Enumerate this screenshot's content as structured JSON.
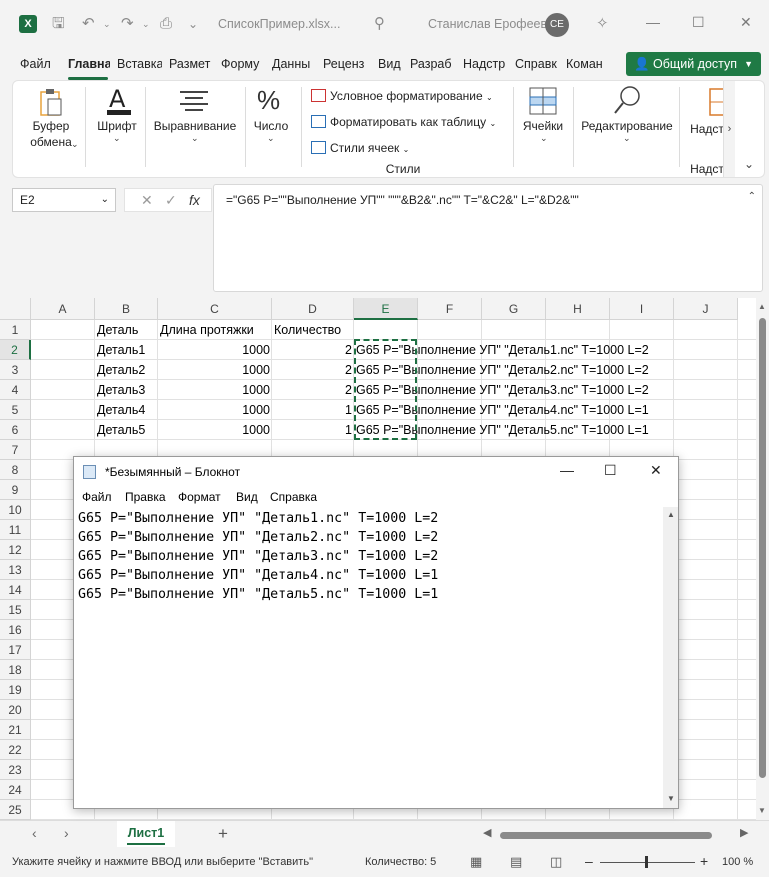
{
  "titlebar": {
    "filename": "СписокПример.xlsx...",
    "user": "Станислав Ерофеев",
    "avatar": "CE",
    "app_icon": "X"
  },
  "ribbon_tabs": [
    "Файл",
    "Главна",
    "Вставка",
    "Размет",
    "Форму",
    "Данны",
    "Реценз",
    "Вид",
    "Разраб",
    "Надстр",
    "Справк",
    "Коман"
  ],
  "share_label": "Общий доступ",
  "ribbon": {
    "clipboard_line1": "Буфер",
    "clipboard_line2": "обмена",
    "font": "Шрифт",
    "alignment": "Выравнивание",
    "number": "Число",
    "cond_format": "Условное форматирование",
    "format_table": "Форматировать как таблицу",
    "cell_styles": "Стили ячеек",
    "styles_group": "Стили",
    "cells": "Ячейки",
    "editing": "Редактирование",
    "addins": "Надст",
    "addins_group": "Надст"
  },
  "formula_bar": {
    "namebox": "E2",
    "formula": "=\"G65 P=\"\"Выполнение УП\"\" \"\"\"&B2&\".nc\"\" T=\"&C2&\" L=\"&D2&\"\""
  },
  "grid": {
    "columns": [
      "A",
      "B",
      "C",
      "D",
      "E",
      "F",
      "G",
      "H",
      "I",
      "J"
    ],
    "rows": [
      "1",
      "2",
      "3",
      "4",
      "5",
      "6",
      "7",
      "8",
      "9",
      "10",
      "11",
      "12",
      "13",
      "14",
      "15",
      "16",
      "17",
      "18",
      "19",
      "20",
      "21",
      "22",
      "23",
      "24",
      "25"
    ],
    "header_row": [
      "Деталь",
      "Длина протяжки",
      "Количество"
    ],
    "data": [
      {
        "b": "Деталь1",
        "c": "1000",
        "d": "2",
        "e": "G65 P=\"Выполнение УП\" \"Деталь1.nc\" T=1000 L=2"
      },
      {
        "b": "Деталь2",
        "c": "1000",
        "d": "2",
        "e": "G65 P=\"Выполнение УП\" \"Деталь2.nc\" T=1000 L=2"
      },
      {
        "b": "Деталь3",
        "c": "1000",
        "d": "2",
        "e": "G65 P=\"Выполнение УП\" \"Деталь3.nc\" T=1000 L=2"
      },
      {
        "b": "Деталь4",
        "c": "1000",
        "d": "1",
        "e": "G65 P=\"Выполнение УП\" \"Деталь4.nc\" T=1000 L=1"
      },
      {
        "b": "Деталь5",
        "c": "1000",
        "d": "1",
        "e": "G65 P=\"Выполнение УП\" \"Деталь5.nc\" T=1000 L=1"
      }
    ]
  },
  "sheet_tab": "Лист1",
  "status": {
    "message": "Укажите ячейку и нажмите ВВОД или выберите \"Вставить\"",
    "count": "Количество: 5",
    "zoom": "100 %",
    "zoom_level": 1.0
  },
  "notepad": {
    "title": "*Безымянный – Блокнот",
    "menu": [
      "Файл",
      "Правка",
      "Формат",
      "Вид",
      "Справка"
    ],
    "lines": [
      "G65 P=\"Выполнение УП\" \"Деталь1.nc\" T=1000 L=2",
      "G65 P=\"Выполнение УП\" \"Деталь2.nc\" T=1000 L=2",
      "G65 P=\"Выполнение УП\" \"Деталь3.nc\" T=1000 L=2",
      "G65 P=\"Выполнение УП\" \"Деталь4.nc\" T=1000 L=1",
      "G65 P=\"Выполнение УП\" \"Деталь5.nc\" T=1000 L=1"
    ]
  },
  "colors": {
    "accent": "#1d6f42",
    "share": "#1f7a45"
  }
}
